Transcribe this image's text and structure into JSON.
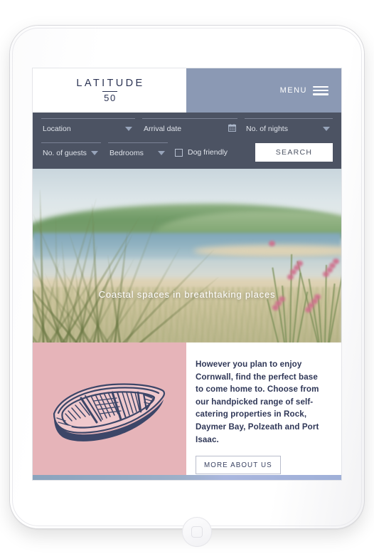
{
  "device": {
    "name": "tablet-device-frame",
    "camera_icon": "camera-dot-icon",
    "sensor_icon": "ambient-light-sensor-icon",
    "home_button": "home-button"
  },
  "header": {
    "logo": {
      "word": "LATITUDE",
      "number": "50"
    },
    "menu_label": "MENU",
    "menu_icon": "hamburger-menu-icon"
  },
  "search": {
    "fields": {
      "location": {
        "label": "Location",
        "icon": "chevron-down-icon"
      },
      "arrival_date": {
        "label": "Arrival date",
        "icon": "calendar-icon"
      },
      "nights": {
        "label": "No. of nights",
        "icon": "chevron-down-icon"
      },
      "guests": {
        "label": "No. of guests",
        "icon": "chevron-down-icon"
      },
      "bedrooms": {
        "label": "Bedrooms",
        "icon": "chevron-down-icon"
      },
      "dog_friendly": {
        "label": "Dog friendly",
        "checked": false
      }
    },
    "search_button_label": "SEARCH"
  },
  "hero": {
    "caption": "Coastal spaces in breathtaking places",
    "image_alt": "coastal estuary with dune grass and pink sea thrift flowers"
  },
  "intro": {
    "illustration": "rowing-boat-illustration",
    "paragraph": "However you plan to enjoy Cornwall, find the perfect base to come home to. Choose from our handpicked range of self-catering properties in Rock, Daymer Bay, Polzeath and Port Isaac.",
    "cta_label": "MORE ABOUT US"
  },
  "colors": {
    "brand_navy": "#2c3454",
    "header_blue": "#8b99b4",
    "search_bar": "#4c5363",
    "pink_panel": "#e6b4b9",
    "strip_blue": "#9db0c9"
  }
}
